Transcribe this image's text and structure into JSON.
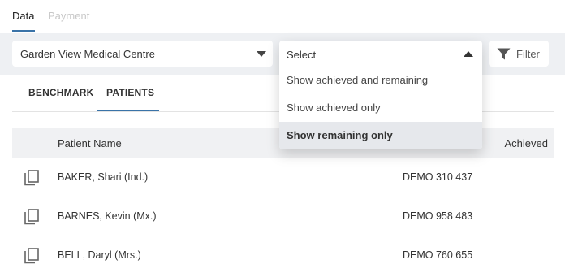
{
  "top_tabs": {
    "data": "Data",
    "payment": "Payment"
  },
  "filters": {
    "practice": "Garden View Medical Centre",
    "status_select_label": "Select",
    "status_options": [
      "Show achieved and remaining",
      "Show achieved only",
      "Show remaining only"
    ],
    "filter_button": "Filter"
  },
  "sub_tabs": {
    "benchmark": "BENCHMARK",
    "patients": "PATIENTS"
  },
  "table": {
    "columns": {
      "name": "Patient Name",
      "achieved": "Achieved"
    },
    "rows": [
      {
        "name": "BAKER, Shari (Ind.)",
        "id": "DEMO 310 437"
      },
      {
        "name": "BARNES, Kevin (Mx.)",
        "id": "DEMO 958 483"
      },
      {
        "name": "BELL, Daryl (Mrs.)",
        "id": "DEMO 760 655"
      }
    ]
  },
  "colors": {
    "accent": "#3a73a8",
    "filter_bar_bg": "#eef0f3",
    "header_bg": "#f0f1f3",
    "highlight": "#e6e8ec"
  },
  "icons": {
    "caret": "chevron-down-icon",
    "caret_open": "chevron-up-icon",
    "filter": "funnel-icon",
    "copy": "copy-icon"
  }
}
